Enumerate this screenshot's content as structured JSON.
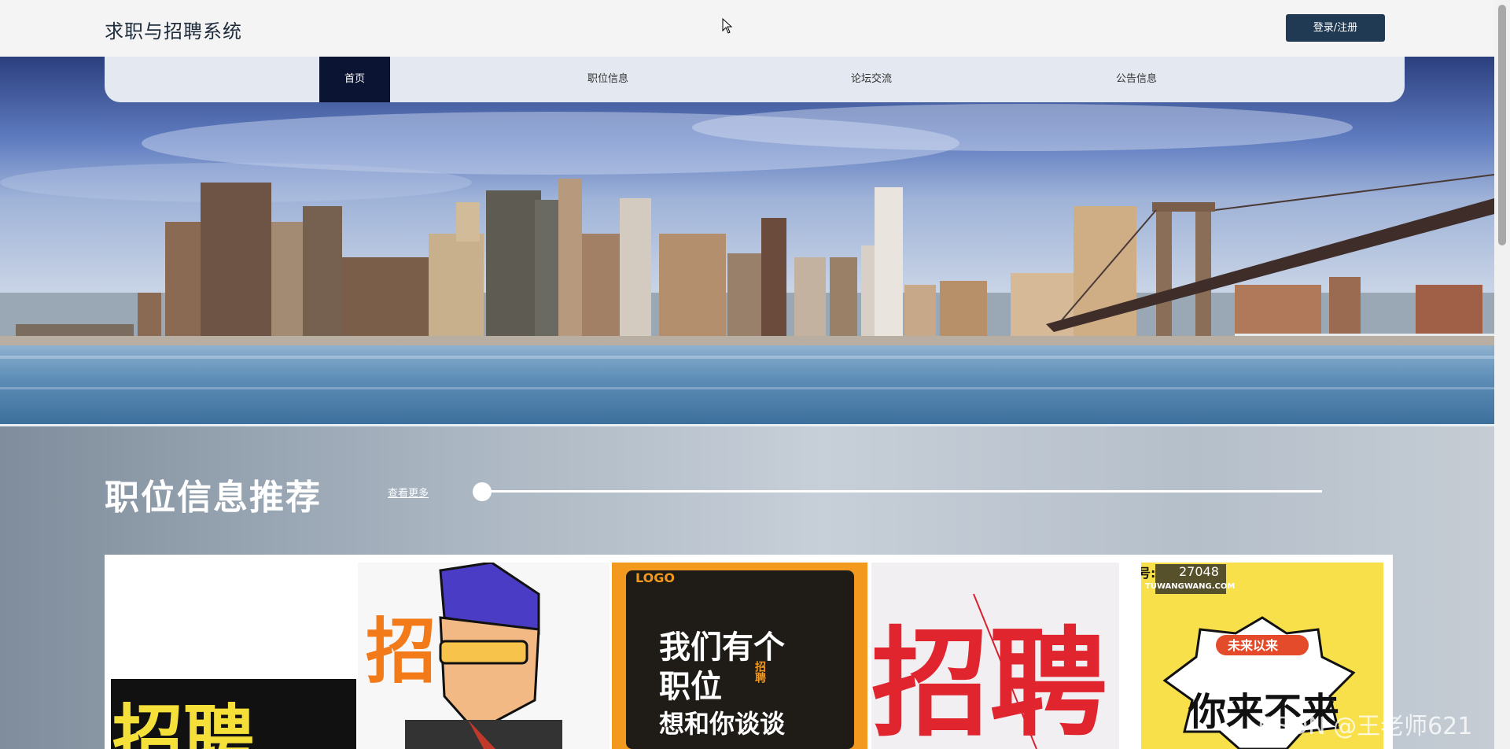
{
  "header": {
    "site_title": "求职与招聘系统",
    "login_label": "登录/注册"
  },
  "nav": {
    "items": [
      {
        "label": "首页",
        "active": true
      },
      {
        "label": "职位信息",
        "active": false
      },
      {
        "label": "论坛交流",
        "active": false
      },
      {
        "label": "公告信息",
        "active": false
      }
    ]
  },
  "hero": {
    "image": "city-skyline-bridge-banner"
  },
  "recommend": {
    "title": "职位信息推荐",
    "more_label": "查看更多",
    "slider_position": 0,
    "cards": [
      {
        "image": "recruit-poster-yellow",
        "text": "招聘"
      },
      {
        "image": "recruit-cartoon-man",
        "text": "招"
      },
      {
        "image": "recruit-orange-poster",
        "text_lines": [
          "我们有个",
          "职位",
          "想和你谈谈"
        ],
        "logo": "LOGO",
        "badge": "招聘"
      },
      {
        "image": "recruit-red-poster",
        "text": "招聘"
      },
      {
        "image": "recruit-comic-poster",
        "number": "27048",
        "site": "TUWANGWANG.COM",
        "banner": "未来以来",
        "text": "你来不来",
        "prefix": "号:"
      }
    ]
  },
  "watermark": "CSDN @王老师621",
  "colors": {
    "header_bg": "#f4f4f5",
    "nav_bg": "#e4e8f0",
    "nav_active": "#0b1533",
    "login_btn": "#1f3a52"
  }
}
